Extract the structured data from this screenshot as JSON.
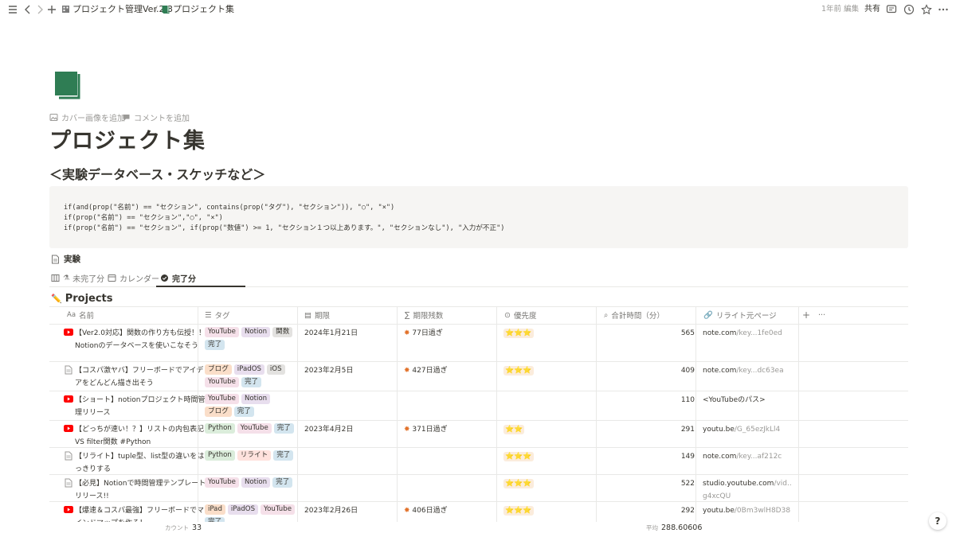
{
  "topbar": {
    "breadcrumb_parent": "プロジェクト管理Ver.2.3",
    "breadcrumb_sep": "/",
    "breadcrumb_current": "プロジェクト集",
    "edited": "1年前 編集",
    "share": "共有"
  },
  "page": {
    "add_cover": "カバー画像を追加",
    "add_comment": "コメントを追加",
    "title": "プロジェクト集",
    "heading": "＜実験データベース・スケッチなど＞",
    "subpage": "実験"
  },
  "code": {
    "line1": "if(and(prop(\"名前\") == \"セクション\", contains(prop(\"タグ\"), \"セクション\")), \"○\", \"×\")",
    "line2": "if(prop(\"名前\") == \"セクション\",\"○\", \"×\")",
    "line3": "if(prop(\"名前\") == \"セクション\", if(prop(\"数値\") >= 1, \"セクション１つ以上あります。\", \"セクションなし\"), \"入力が不正\")"
  },
  "views": {
    "v1": "未完了分",
    "v2": "カレンダー",
    "v3": "完了分"
  },
  "db": {
    "title": "Projects",
    "col_name": "名前",
    "col_tag": "タグ",
    "col_due": "期限",
    "col_remain": "期限残数",
    "col_priority": "優先度",
    "col_total": "合計時間（分）",
    "col_rollup": "リライト元ページ"
  },
  "rows": [
    {
      "name": "【Ver2.0対応】関数の作り方も伝授！！Notionのデータベースを使いこなそう",
      "icon": "youtube-icon",
      "tags": [
        "YouTube",
        "Notion",
        "関数",
        "完了"
      ],
      "due": "2024年1月21日",
      "remain": "77日過ぎ",
      "stars": "⭐⭐⭐",
      "total": "565",
      "link_a": "note.com",
      "link_b": "/key...1fe0ed"
    },
    {
      "name": "【コスパ激ヤバ】フリーボードでアイデアをどんどん描き出そう",
      "icon": "page-icon",
      "tags": [
        "ブログ",
        "iPadOS",
        "iOS",
        "YouTube",
        "完了"
      ],
      "due": "2023年2月5日",
      "remain": "427日過ぎ",
      "stars": "⭐⭐⭐",
      "total": "409",
      "link_a": "note.com",
      "link_b": "/key...dc63ea"
    },
    {
      "name": "【ショート】notionプロジェクト時間管理リリース",
      "icon": "youtube-icon",
      "tags": [
        "YouTube",
        "Notion",
        "ブログ",
        "完了"
      ],
      "due": "",
      "remain": "",
      "stars": "",
      "total": "110",
      "link_a": "<YouTubeのパス>",
      "link_b": ""
    },
    {
      "name": "【どっちが速い！？】リストの内包表記VS filter関数 #Python",
      "icon": "youtube-icon",
      "tags": [
        "Python",
        "YouTube",
        "完了"
      ],
      "due": "2023年4月2日",
      "remain": "371日過ぎ",
      "stars": "⭐⭐",
      "total": "291",
      "link_a": "youtu.be",
      "link_b": "/G_65ezJkLl4"
    },
    {
      "name": "【リライト】tuple型、list型の違いをはっきりする",
      "icon": "page-icon",
      "tags": [
        "Python",
        "リライト",
        "完了"
      ],
      "due": "",
      "remain": "",
      "stars": "⭐⭐⭐",
      "total": "149",
      "link_a": "note.com",
      "link_b": "/key...af212c"
    },
    {
      "name": "【必見】Notionで時間管理テンプレートリリース!!",
      "icon": "page-icon",
      "tags": [
        "YouTube",
        "Notion",
        "完了"
      ],
      "due": "",
      "remain": "",
      "stars": "⭐⭐⭐",
      "total": "522",
      "link_a": "studio.youtube.com",
      "link_b": "/vid...",
      "link_c": "g4xcQU"
    },
    {
      "name": "【爆速＆コスパ最強】フリーボードでマインドマップを作る！",
      "icon": "youtube-icon",
      "tags": [
        "iPad",
        "iPadOS",
        "YouTube",
        "完了"
      ],
      "due": "2023年2月26日",
      "remain": "406日過ぎ",
      "stars": "⭐⭐⭐",
      "total": "292",
      "link_a": "youtu.be",
      "link_b": "/0Bm3wlH8D38"
    }
  ],
  "tag_colors": {
    "YouTube": "#f5e0e9",
    "Notion": "#e8deee",
    "関数": "#e3e2e0",
    "完了": "#d3e5ef",
    "ブログ": "#fadec9",
    "iPadOS": "#e8deee",
    "iOS": "#e3e2e0",
    "Python": "#dbeddb",
    "リライト": "#ffe2dd",
    "iPad": "#fadec9"
  },
  "footer": {
    "count_label": "カウント",
    "count_value": "33",
    "avg_label": "平均",
    "avg_value": "288.60606",
    "help": "?"
  }
}
